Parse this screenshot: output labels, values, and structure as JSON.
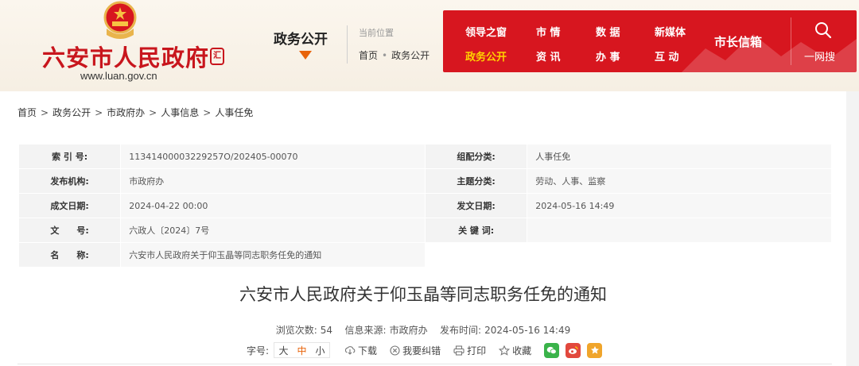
{
  "header": {
    "site_title": "六安市人民政府",
    "seal_text": "汇",
    "site_url": "www.luan.gov.cn",
    "column_name": "政务公开",
    "location_label": "当前位置",
    "location_path": [
      "首页",
      "政务公开"
    ]
  },
  "nav": {
    "items": [
      {
        "label": "领导之窗",
        "active": false
      },
      {
        "label": "市 情",
        "active": false
      },
      {
        "label": "数 据",
        "active": false
      },
      {
        "label": "新媒体",
        "active": false
      },
      {
        "label": "政务公开",
        "active": true
      },
      {
        "label": "资 讯",
        "active": false
      },
      {
        "label": "办 事",
        "active": false
      },
      {
        "label": "互 动",
        "active": false
      }
    ],
    "mayor_box": "市长信箱",
    "search_label": "一网搜"
  },
  "breadcrumb": [
    "首页",
    "政务公开",
    "市政府办",
    "人事信息",
    "人事任免"
  ],
  "meta": {
    "index_label": "索 引 号:",
    "index_value": "11341400003229257O/202405-00070",
    "category_label": "组配分类:",
    "category_value": "人事任免",
    "publisher_label": "发布机构:",
    "publisher_value": "市政府办",
    "topic_label": "主题分类:",
    "topic_value": "劳动、人事、监察",
    "created_label": "成文日期:",
    "created_value": "2024-04-22 00:00",
    "published_label": "发文日期:",
    "published_value": "2024-05-16 14:49",
    "docno_label": "文　　号:",
    "docno_value": "六政人〔2024〕7号",
    "keywords_label": "关 键 词:",
    "keywords_value": "",
    "name_label": "名　　称:",
    "name_value": "六安市人民政府关于仰玉晶等同志职务任免的通知"
  },
  "article": {
    "title": "六安市人民政府关于仰玉晶等同志职务任免的通知",
    "views_label": "浏览次数:",
    "views_value": "54",
    "source_label": "信息来源:",
    "source_value": "市政府办",
    "time_label": "发布时间:",
    "time_value": "2024-05-16 14:49"
  },
  "tools": {
    "fontsize_label": "字号:",
    "sizes": [
      "大",
      "中",
      "小"
    ],
    "download": "下载",
    "report_error": "我要纠错",
    "print": "打印",
    "favorite": "收藏"
  },
  "colors": {
    "brand_red": "#d7161f",
    "title_red": "#c8161d",
    "active_yellow": "#ffd200",
    "accent_orange": "#e8630a"
  }
}
